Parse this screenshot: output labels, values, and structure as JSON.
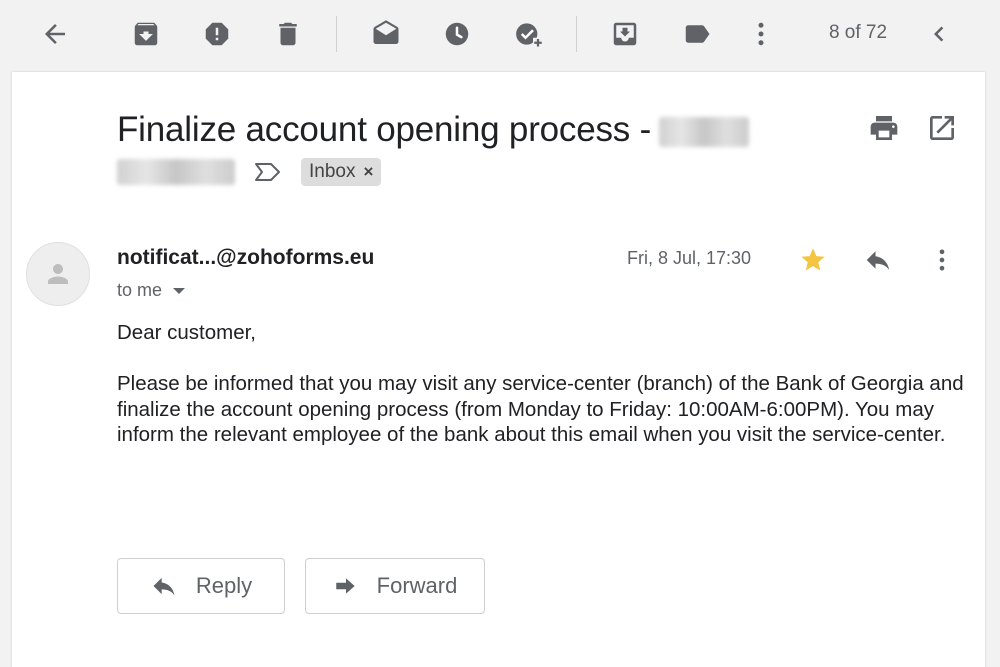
{
  "toolbar": {
    "buttons": [
      {
        "name": "back-button",
        "icon": "arrow-left-icon"
      },
      {
        "name": "archive-button",
        "icon": "archive-icon"
      },
      {
        "name": "report-spam-button",
        "icon": "report-spam-icon"
      },
      {
        "name": "delete-button",
        "icon": "trash-icon"
      },
      {
        "name": "mark-unread-button",
        "icon": "envelope-open-icon"
      },
      {
        "name": "snooze-button",
        "icon": "clock-icon"
      },
      {
        "name": "add-task-button",
        "icon": "add-task-icon"
      },
      {
        "name": "move-to-button",
        "icon": "move-to-inbox-icon"
      },
      {
        "name": "labels-button",
        "icon": "label-icon"
      },
      {
        "name": "more-button",
        "icon": "vertical-dots-icon"
      }
    ],
    "pager": "8 of 72"
  },
  "email": {
    "subject": "Finalize account opening process -",
    "label": "Inbox",
    "label_remove": "×",
    "sender": "notificat...@zohoforms.eu",
    "to": "to me",
    "date": "Fri, 8 Jul, 17:30",
    "starred": true,
    "greeting": "Dear customer,",
    "body": "Please be informed that you may visit any service-center (branch) of the Bank of Georgia and finalize the account opening process (from Monday to Friday: 10:00AM-6:00PM). You may inform the relevant employee of the bank about this email when you visit the service-center."
  },
  "actions": {
    "reply": "Reply",
    "forward": "Forward"
  },
  "colors": {
    "icon": "#5f6368",
    "star": "#f4c542",
    "label_chip": "#dddddd",
    "toolbar_bg": "#f2f2f2"
  }
}
